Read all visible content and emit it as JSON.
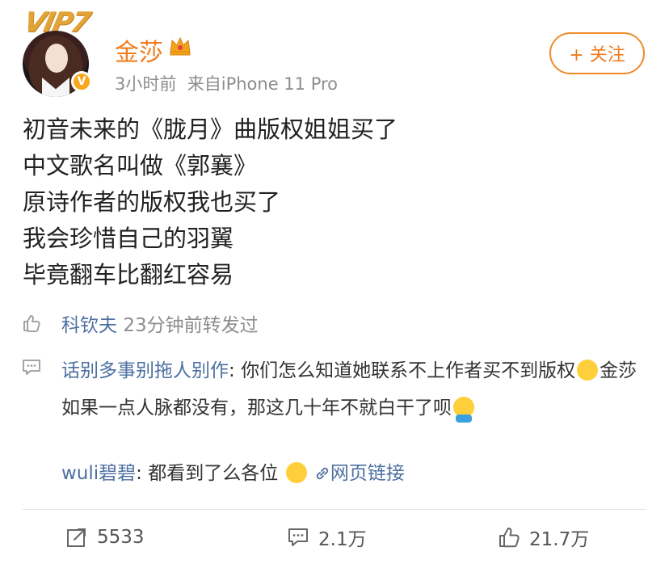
{
  "header": {
    "vip_label": "VIP7",
    "name": "金莎",
    "time": "3小时前",
    "source": "来自iPhone 11 Pro",
    "follow_label": "+ 关注"
  },
  "post": {
    "lines": [
      "初音未来的《胧月》曲版权姐姐买了",
      "中文歌名叫做《郭襄》",
      "原诗作者的版权我也买了",
      "我会珍惜自己的羽翼",
      "毕竟翻车比翻红容易"
    ]
  },
  "comments": {
    "like_user": "科钦夫",
    "like_text": "23分钟前转发过",
    "c1_user": "话别多事别拖人别作",
    "c1_text_a": "你们怎么知道她联系不上作者买不到版权",
    "c1_text_b": "金莎如果一点人脉都没有，那这几十年不就白干了呗",
    "c2_user": "wuli碧碧",
    "c2_text": "都看到了么各位",
    "c2_link": "网页链接"
  },
  "footer": {
    "repost": "5533",
    "comments": "2.1万",
    "likes": "21.7万"
  },
  "colors": {
    "brand_orange": "#f07c1e",
    "link_blue": "#4d6fa1",
    "meta_gray": "#8d8d8d"
  },
  "icons": [
    "vip-badge-icon",
    "verified-icon",
    "crown-icon",
    "like-icon",
    "comment-icon",
    "repost-icon",
    "link-icon"
  ]
}
